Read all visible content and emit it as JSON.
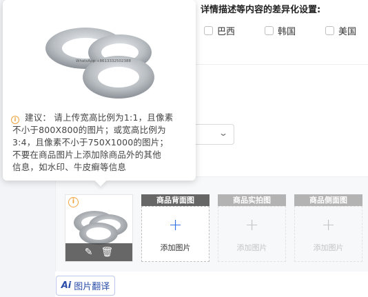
{
  "header": {
    "title": "详情描述等内容的差异化设置:"
  },
  "countries": [
    {
      "label": "巴西",
      "checked": false
    },
    {
      "label": "韩国",
      "checked": false
    },
    {
      "label": "美国",
      "checked": false
    }
  ],
  "popover": {
    "watermark": "WhatsApp:+8613332502388",
    "tip_lines": [
      "建议： 请上传宽高比例为1:1，且像素",
      "不小于800X800的图片；或宽高比例为",
      "3:4，且像素不小于750X1000的图片；",
      "不要在商品图片上添加除商品外的其他",
      "信息，如水印、牛皮癣等信息"
    ]
  },
  "image_slots": [
    {
      "title": "商品背面图",
      "add_label": "添加图片",
      "state": "active"
    },
    {
      "title": "商品实拍图",
      "add_label": "添加图片",
      "state": "muted"
    },
    {
      "title": "商品侧面图",
      "add_label": "添加图片",
      "state": "muted"
    }
  ],
  "thumbnail": {
    "edit_icon": "pencil-icon",
    "delete_icon": "trash-icon",
    "warning_icon": "info-circle-icon"
  },
  "translate_button": {
    "icon": "Ai",
    "label": "图片翻译"
  },
  "colors": {
    "accent": "#2f6fe8",
    "warning": "#f0a33a",
    "slot_header": "#777777"
  }
}
